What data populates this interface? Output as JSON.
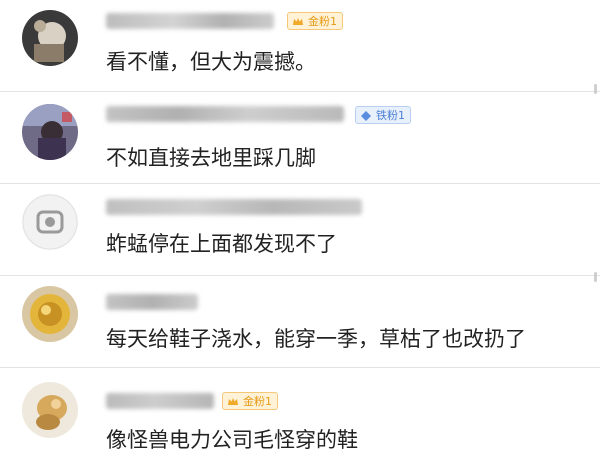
{
  "comments": [
    {
      "username": "哈哈儿田园欢迎了",
      "badge": {
        "label": "金粉1",
        "type": "gold",
        "icon": "crown-icon"
      },
      "text": "看不懂，但大为震撼。"
    },
    {
      "username": "理想沙滩铺满大面的禁言宝",
      "badge": {
        "label": "铁粉1",
        "type": "iron",
        "icon": "diamond-icon"
      },
      "text": "不如直接去地里踩几脚"
    },
    {
      "username": "周小脑在 5 宝 4 北之 5 间台",
      "badge": null,
      "text": "蚱蜢停在上面都发现不了"
    },
    {
      "username": "五大大11",
      "badge": null,
      "text": "每天给鞋子浇水，能穿一季，草枯了也改扔了"
    },
    {
      "username": "伴马獭A66",
      "badge": {
        "label": "金粉1",
        "type": "gold",
        "icon": "crown-icon"
      },
      "text": "像怪兽电力公司毛怪穿的鞋"
    }
  ],
  "colors": {
    "gold_badge": "#e69a17",
    "iron_badge": "#4b7fd3",
    "text": "#222222",
    "divider": "#e3e3e3"
  }
}
